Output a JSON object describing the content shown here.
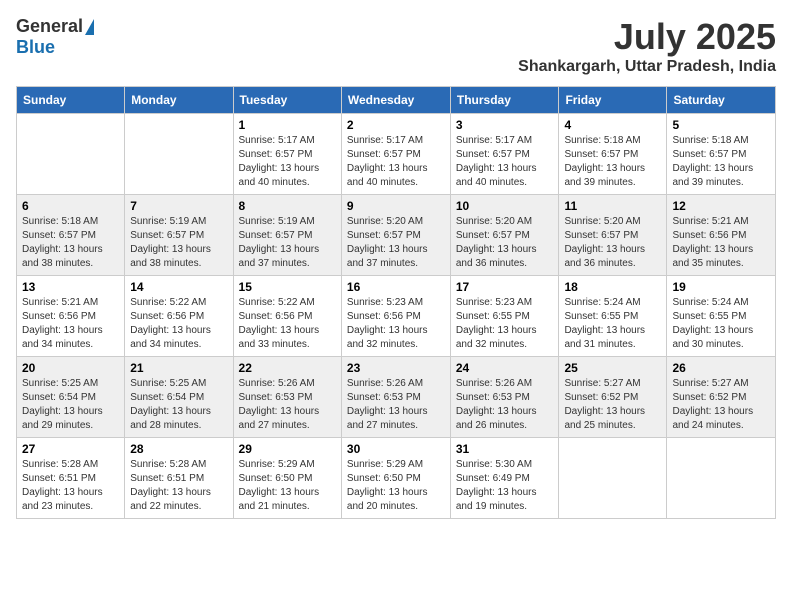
{
  "header": {
    "logo_general": "General",
    "logo_blue": "Blue",
    "month_year": "July 2025",
    "location": "Shankargarh, Uttar Pradesh, India"
  },
  "weekdays": [
    "Sunday",
    "Monday",
    "Tuesday",
    "Wednesday",
    "Thursday",
    "Friday",
    "Saturday"
  ],
  "weeks": [
    [
      {
        "day": "",
        "sunrise": "",
        "sunset": "",
        "daylight": ""
      },
      {
        "day": "",
        "sunrise": "",
        "sunset": "",
        "daylight": ""
      },
      {
        "day": "1",
        "sunrise": "Sunrise: 5:17 AM",
        "sunset": "Sunset: 6:57 PM",
        "daylight": "Daylight: 13 hours and 40 minutes."
      },
      {
        "day": "2",
        "sunrise": "Sunrise: 5:17 AM",
        "sunset": "Sunset: 6:57 PM",
        "daylight": "Daylight: 13 hours and 40 minutes."
      },
      {
        "day": "3",
        "sunrise": "Sunrise: 5:17 AM",
        "sunset": "Sunset: 6:57 PM",
        "daylight": "Daylight: 13 hours and 40 minutes."
      },
      {
        "day": "4",
        "sunrise": "Sunrise: 5:18 AM",
        "sunset": "Sunset: 6:57 PM",
        "daylight": "Daylight: 13 hours and 39 minutes."
      },
      {
        "day": "5",
        "sunrise": "Sunrise: 5:18 AM",
        "sunset": "Sunset: 6:57 PM",
        "daylight": "Daylight: 13 hours and 39 minutes."
      }
    ],
    [
      {
        "day": "6",
        "sunrise": "Sunrise: 5:18 AM",
        "sunset": "Sunset: 6:57 PM",
        "daylight": "Daylight: 13 hours and 38 minutes."
      },
      {
        "day": "7",
        "sunrise": "Sunrise: 5:19 AM",
        "sunset": "Sunset: 6:57 PM",
        "daylight": "Daylight: 13 hours and 38 minutes."
      },
      {
        "day": "8",
        "sunrise": "Sunrise: 5:19 AM",
        "sunset": "Sunset: 6:57 PM",
        "daylight": "Daylight: 13 hours and 37 minutes."
      },
      {
        "day": "9",
        "sunrise": "Sunrise: 5:20 AM",
        "sunset": "Sunset: 6:57 PM",
        "daylight": "Daylight: 13 hours and 37 minutes."
      },
      {
        "day": "10",
        "sunrise": "Sunrise: 5:20 AM",
        "sunset": "Sunset: 6:57 PM",
        "daylight": "Daylight: 13 hours and 36 minutes."
      },
      {
        "day": "11",
        "sunrise": "Sunrise: 5:20 AM",
        "sunset": "Sunset: 6:57 PM",
        "daylight": "Daylight: 13 hours and 36 minutes."
      },
      {
        "day": "12",
        "sunrise": "Sunrise: 5:21 AM",
        "sunset": "Sunset: 6:56 PM",
        "daylight": "Daylight: 13 hours and 35 minutes."
      }
    ],
    [
      {
        "day": "13",
        "sunrise": "Sunrise: 5:21 AM",
        "sunset": "Sunset: 6:56 PM",
        "daylight": "Daylight: 13 hours and 34 minutes."
      },
      {
        "day": "14",
        "sunrise": "Sunrise: 5:22 AM",
        "sunset": "Sunset: 6:56 PM",
        "daylight": "Daylight: 13 hours and 34 minutes."
      },
      {
        "day": "15",
        "sunrise": "Sunrise: 5:22 AM",
        "sunset": "Sunset: 6:56 PM",
        "daylight": "Daylight: 13 hours and 33 minutes."
      },
      {
        "day": "16",
        "sunrise": "Sunrise: 5:23 AM",
        "sunset": "Sunset: 6:56 PM",
        "daylight": "Daylight: 13 hours and 32 minutes."
      },
      {
        "day": "17",
        "sunrise": "Sunrise: 5:23 AM",
        "sunset": "Sunset: 6:55 PM",
        "daylight": "Daylight: 13 hours and 32 minutes."
      },
      {
        "day": "18",
        "sunrise": "Sunrise: 5:24 AM",
        "sunset": "Sunset: 6:55 PM",
        "daylight": "Daylight: 13 hours and 31 minutes."
      },
      {
        "day": "19",
        "sunrise": "Sunrise: 5:24 AM",
        "sunset": "Sunset: 6:55 PM",
        "daylight": "Daylight: 13 hours and 30 minutes."
      }
    ],
    [
      {
        "day": "20",
        "sunrise": "Sunrise: 5:25 AM",
        "sunset": "Sunset: 6:54 PM",
        "daylight": "Daylight: 13 hours and 29 minutes."
      },
      {
        "day": "21",
        "sunrise": "Sunrise: 5:25 AM",
        "sunset": "Sunset: 6:54 PM",
        "daylight": "Daylight: 13 hours and 28 minutes."
      },
      {
        "day": "22",
        "sunrise": "Sunrise: 5:26 AM",
        "sunset": "Sunset: 6:53 PM",
        "daylight": "Daylight: 13 hours and 27 minutes."
      },
      {
        "day": "23",
        "sunrise": "Sunrise: 5:26 AM",
        "sunset": "Sunset: 6:53 PM",
        "daylight": "Daylight: 13 hours and 27 minutes."
      },
      {
        "day": "24",
        "sunrise": "Sunrise: 5:26 AM",
        "sunset": "Sunset: 6:53 PM",
        "daylight": "Daylight: 13 hours and 26 minutes."
      },
      {
        "day": "25",
        "sunrise": "Sunrise: 5:27 AM",
        "sunset": "Sunset: 6:52 PM",
        "daylight": "Daylight: 13 hours and 25 minutes."
      },
      {
        "day": "26",
        "sunrise": "Sunrise: 5:27 AM",
        "sunset": "Sunset: 6:52 PM",
        "daylight": "Daylight: 13 hours and 24 minutes."
      }
    ],
    [
      {
        "day": "27",
        "sunrise": "Sunrise: 5:28 AM",
        "sunset": "Sunset: 6:51 PM",
        "daylight": "Daylight: 13 hours and 23 minutes."
      },
      {
        "day": "28",
        "sunrise": "Sunrise: 5:28 AM",
        "sunset": "Sunset: 6:51 PM",
        "daylight": "Daylight: 13 hours and 22 minutes."
      },
      {
        "day": "29",
        "sunrise": "Sunrise: 5:29 AM",
        "sunset": "Sunset: 6:50 PM",
        "daylight": "Daylight: 13 hours and 21 minutes."
      },
      {
        "day": "30",
        "sunrise": "Sunrise: 5:29 AM",
        "sunset": "Sunset: 6:50 PM",
        "daylight": "Daylight: 13 hours and 20 minutes."
      },
      {
        "day": "31",
        "sunrise": "Sunrise: 5:30 AM",
        "sunset": "Sunset: 6:49 PM",
        "daylight": "Daylight: 13 hours and 19 minutes."
      },
      {
        "day": "",
        "sunrise": "",
        "sunset": "",
        "daylight": ""
      },
      {
        "day": "",
        "sunrise": "",
        "sunset": "",
        "daylight": ""
      }
    ]
  ]
}
